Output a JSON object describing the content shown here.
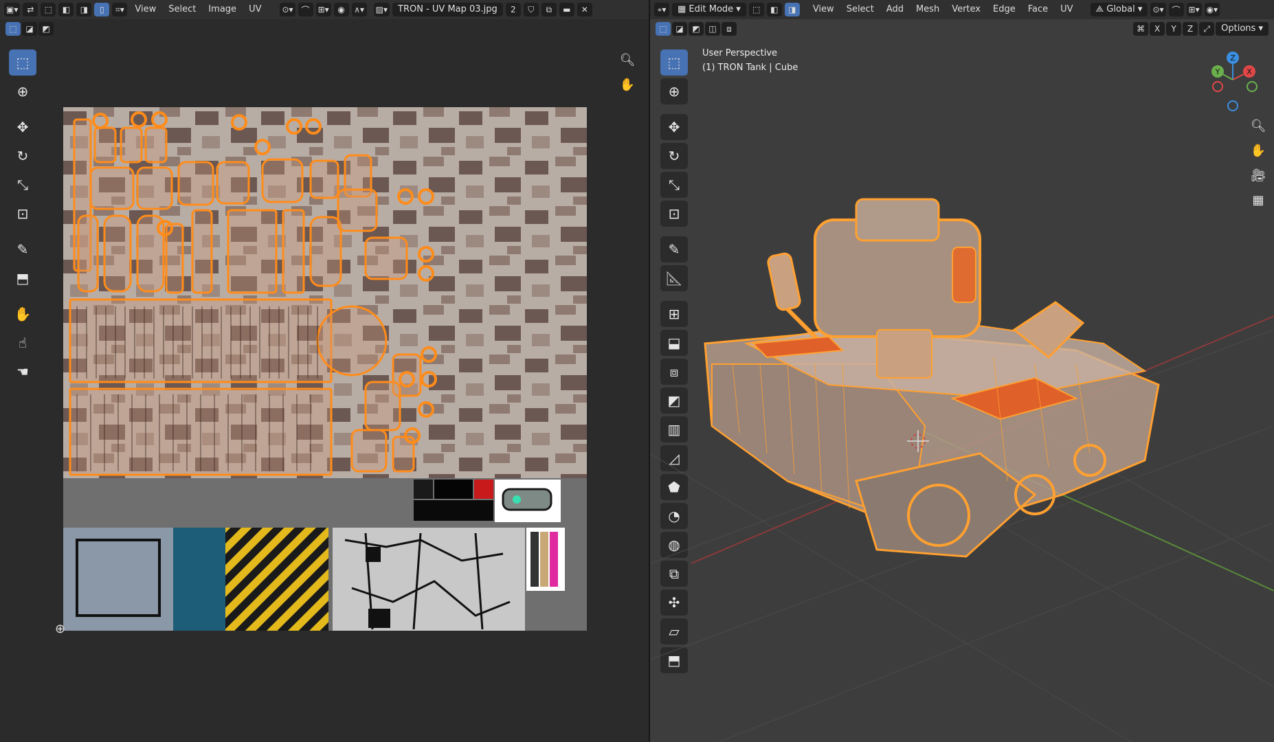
{
  "uv_editor": {
    "menus": [
      "View",
      "Select",
      "Image",
      "UV"
    ],
    "image_name": "TRON - UV Map 03.jpg",
    "users_count": "2",
    "colors": {
      "uv_edge": "#ff8c1a",
      "camo_light": "#b9aea6",
      "camo_dark": "#6b5752"
    }
  },
  "viewport": {
    "mode": "Edit Mode",
    "menus": [
      "View",
      "Select",
      "Add",
      "Mesh",
      "Vertex",
      "Edge",
      "Face",
      "UV"
    ],
    "transform_orientation": "Global",
    "axes": [
      "X",
      "Y",
      "Z"
    ],
    "options_label": "Options",
    "perspective_label": "User Perspective",
    "object_label": "(1) TRON Tank | Cube",
    "gizmo_labels": {
      "z": "Z",
      "y": "Y",
      "x": "X"
    },
    "colors": {
      "selection": "#ffa030",
      "x_axis": "#e04848",
      "y_axis": "#6ab04c",
      "z_axis": "#3b8fe0"
    }
  }
}
